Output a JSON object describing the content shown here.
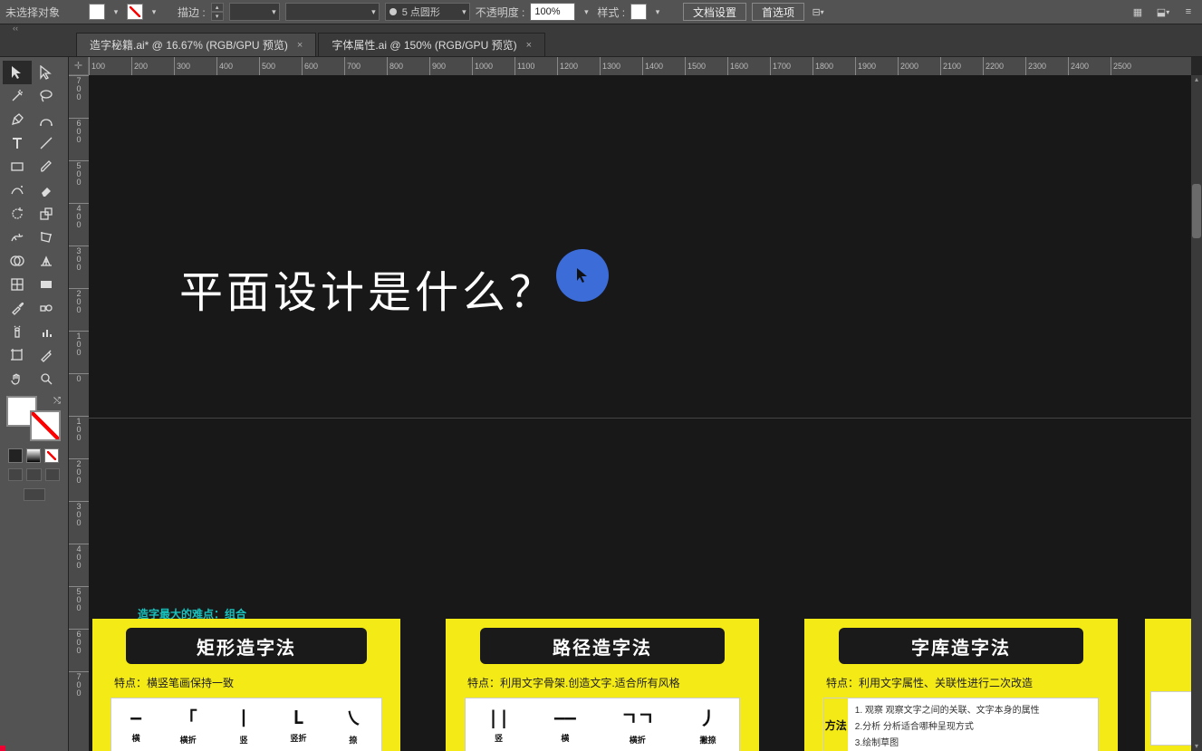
{
  "topbar": {
    "no_selection": "未选择对象",
    "stroke_label": "描边 :",
    "stroke_shape": "5 点圆形",
    "opacity_label": "不透明度 :",
    "opacity_value": "100%",
    "style_label": "样式 :",
    "doc_settings": "文档设置",
    "preferences": "首选项"
  },
  "tabs": [
    {
      "label": "造字秘籍.ai* @ 16.67% (RGB/GPU 预览)",
      "active": true
    },
    {
      "label": "字体属性.ai @ 150% (RGB/GPU 预览)",
      "active": false
    }
  ],
  "ruler_h": [
    "100",
    "200",
    "300",
    "400",
    "500",
    "600",
    "700",
    "800",
    "900",
    "1000",
    "1100",
    "1200",
    "1300",
    "1400",
    "1500",
    "1600",
    "1700",
    "1800",
    "1900",
    "2000",
    "2100",
    "2200",
    "2300",
    "2400",
    "2500"
  ],
  "ruler_v": [
    "700",
    "600",
    "500",
    "400",
    "300",
    "200",
    "100",
    "0",
    "100",
    "200",
    "300",
    "400",
    "500",
    "600",
    "700"
  ],
  "hero": "平面设计是什么？",
  "note": "造字最大的难点：组合",
  "cards": {
    "rect": {
      "title": "矩形造字法",
      "feat": "特点：横竖笔画保持一致",
      "glyph_labels": [
        "横",
        "横折",
        "竖",
        "竖折",
        "捺"
      ]
    },
    "path": {
      "title": "路径造字法",
      "feat": "特点：利用文字骨架.创造文字.适合所有风格",
      "glyph_labels": [
        "竖",
        "横",
        "横折",
        "撇捺"
      ]
    },
    "lib": {
      "title": "字库造字法",
      "feat": "特点：利用文字属性、关联性进行二次改造",
      "method_label": "方法",
      "methods": [
        "1. 观察  观察文字之间的关联、文字本身的属性",
        "2.分析  分析适合哪种呈现方式",
        "3.绘制草图"
      ]
    }
  }
}
